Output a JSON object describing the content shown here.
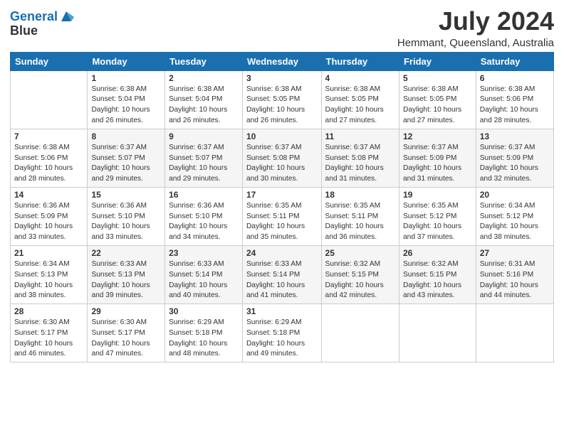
{
  "header": {
    "logo_line1": "General",
    "logo_line2": "Blue",
    "month_year": "July 2024",
    "location": "Hemmant, Queensland, Australia"
  },
  "days_of_week": [
    "Sunday",
    "Monday",
    "Tuesday",
    "Wednesday",
    "Thursday",
    "Friday",
    "Saturday"
  ],
  "weeks": [
    [
      {
        "day": "",
        "content": ""
      },
      {
        "day": "1",
        "content": "Sunrise: 6:38 AM\nSunset: 5:04 PM\nDaylight: 10 hours\nand 26 minutes."
      },
      {
        "day": "2",
        "content": "Sunrise: 6:38 AM\nSunset: 5:04 PM\nDaylight: 10 hours\nand 26 minutes."
      },
      {
        "day": "3",
        "content": "Sunrise: 6:38 AM\nSunset: 5:05 PM\nDaylight: 10 hours\nand 26 minutes."
      },
      {
        "day": "4",
        "content": "Sunrise: 6:38 AM\nSunset: 5:05 PM\nDaylight: 10 hours\nand 27 minutes."
      },
      {
        "day": "5",
        "content": "Sunrise: 6:38 AM\nSunset: 5:05 PM\nDaylight: 10 hours\nand 27 minutes."
      },
      {
        "day": "6",
        "content": "Sunrise: 6:38 AM\nSunset: 5:06 PM\nDaylight: 10 hours\nand 28 minutes."
      }
    ],
    [
      {
        "day": "7",
        "content": "Sunrise: 6:38 AM\nSunset: 5:06 PM\nDaylight: 10 hours\nand 28 minutes."
      },
      {
        "day": "8",
        "content": "Sunrise: 6:37 AM\nSunset: 5:07 PM\nDaylight: 10 hours\nand 29 minutes."
      },
      {
        "day": "9",
        "content": "Sunrise: 6:37 AM\nSunset: 5:07 PM\nDaylight: 10 hours\nand 29 minutes."
      },
      {
        "day": "10",
        "content": "Sunrise: 6:37 AM\nSunset: 5:08 PM\nDaylight: 10 hours\nand 30 minutes."
      },
      {
        "day": "11",
        "content": "Sunrise: 6:37 AM\nSunset: 5:08 PM\nDaylight: 10 hours\nand 31 minutes."
      },
      {
        "day": "12",
        "content": "Sunrise: 6:37 AM\nSunset: 5:09 PM\nDaylight: 10 hours\nand 31 minutes."
      },
      {
        "day": "13",
        "content": "Sunrise: 6:37 AM\nSunset: 5:09 PM\nDaylight: 10 hours\nand 32 minutes."
      }
    ],
    [
      {
        "day": "14",
        "content": "Sunrise: 6:36 AM\nSunset: 5:09 PM\nDaylight: 10 hours\nand 33 minutes."
      },
      {
        "day": "15",
        "content": "Sunrise: 6:36 AM\nSunset: 5:10 PM\nDaylight: 10 hours\nand 33 minutes."
      },
      {
        "day": "16",
        "content": "Sunrise: 6:36 AM\nSunset: 5:10 PM\nDaylight: 10 hours\nand 34 minutes."
      },
      {
        "day": "17",
        "content": "Sunrise: 6:35 AM\nSunset: 5:11 PM\nDaylight: 10 hours\nand 35 minutes."
      },
      {
        "day": "18",
        "content": "Sunrise: 6:35 AM\nSunset: 5:11 PM\nDaylight: 10 hours\nand 36 minutes."
      },
      {
        "day": "19",
        "content": "Sunrise: 6:35 AM\nSunset: 5:12 PM\nDaylight: 10 hours\nand 37 minutes."
      },
      {
        "day": "20",
        "content": "Sunrise: 6:34 AM\nSunset: 5:12 PM\nDaylight: 10 hours\nand 38 minutes."
      }
    ],
    [
      {
        "day": "21",
        "content": "Sunrise: 6:34 AM\nSunset: 5:13 PM\nDaylight: 10 hours\nand 38 minutes."
      },
      {
        "day": "22",
        "content": "Sunrise: 6:33 AM\nSunset: 5:13 PM\nDaylight: 10 hours\nand 39 minutes."
      },
      {
        "day": "23",
        "content": "Sunrise: 6:33 AM\nSunset: 5:14 PM\nDaylight: 10 hours\nand 40 minutes."
      },
      {
        "day": "24",
        "content": "Sunrise: 6:33 AM\nSunset: 5:14 PM\nDaylight: 10 hours\nand 41 minutes."
      },
      {
        "day": "25",
        "content": "Sunrise: 6:32 AM\nSunset: 5:15 PM\nDaylight: 10 hours\nand 42 minutes."
      },
      {
        "day": "26",
        "content": "Sunrise: 6:32 AM\nSunset: 5:15 PM\nDaylight: 10 hours\nand 43 minutes."
      },
      {
        "day": "27",
        "content": "Sunrise: 6:31 AM\nSunset: 5:16 PM\nDaylight: 10 hours\nand 44 minutes."
      }
    ],
    [
      {
        "day": "28",
        "content": "Sunrise: 6:30 AM\nSunset: 5:17 PM\nDaylight: 10 hours\nand 46 minutes."
      },
      {
        "day": "29",
        "content": "Sunrise: 6:30 AM\nSunset: 5:17 PM\nDaylight: 10 hours\nand 47 minutes."
      },
      {
        "day": "30",
        "content": "Sunrise: 6:29 AM\nSunset: 5:18 PM\nDaylight: 10 hours\nand 48 minutes."
      },
      {
        "day": "31",
        "content": "Sunrise: 6:29 AM\nSunset: 5:18 PM\nDaylight: 10 hours\nand 49 minutes."
      },
      {
        "day": "",
        "content": ""
      },
      {
        "day": "",
        "content": ""
      },
      {
        "day": "",
        "content": ""
      }
    ]
  ]
}
